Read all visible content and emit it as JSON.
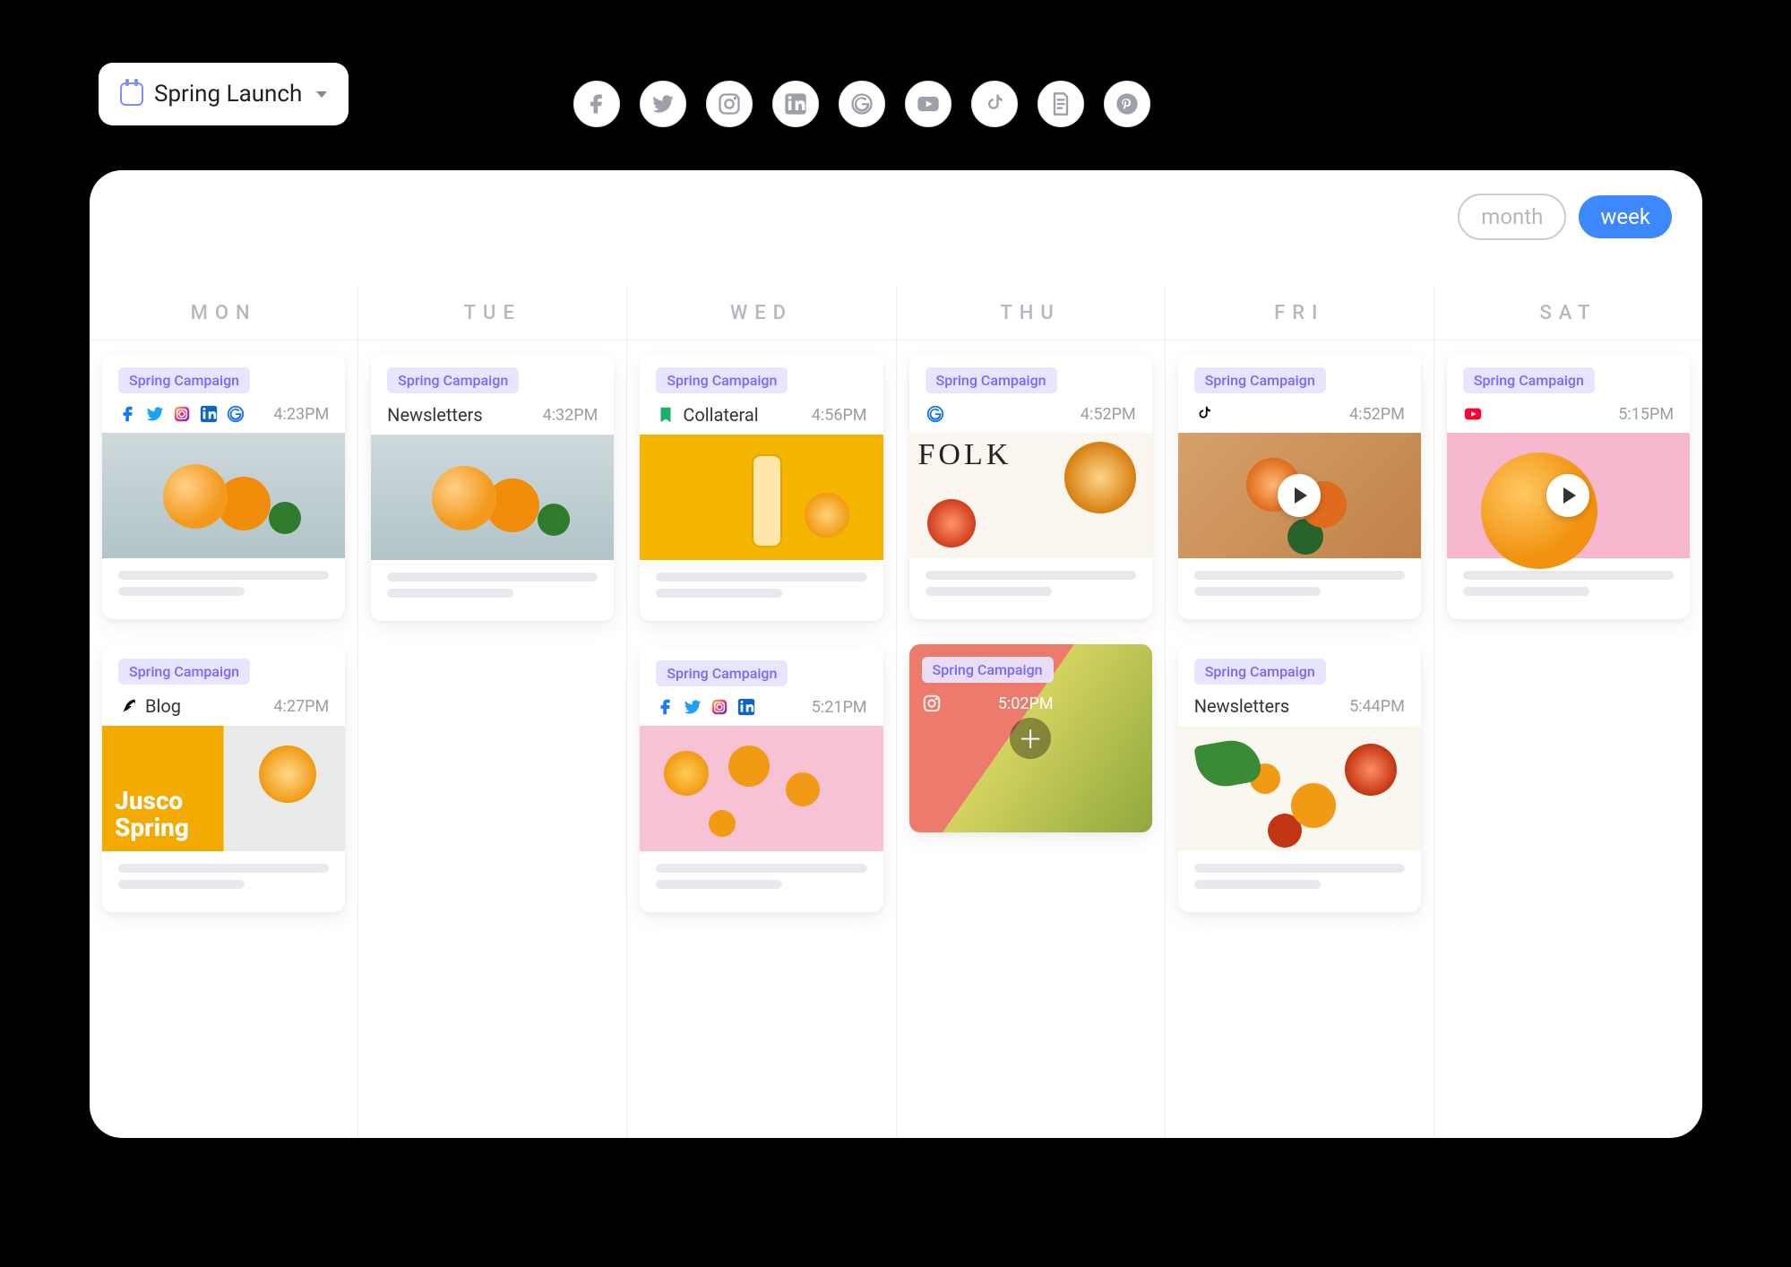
{
  "campaign": {
    "name": "Spring Launch"
  },
  "channels": [
    "facebook",
    "twitter",
    "instagram",
    "linkedin",
    "google",
    "youtube",
    "tiktok",
    "blog",
    "pinterest"
  ],
  "view": {
    "month": "month",
    "week": "week",
    "active": "week"
  },
  "days": [
    "MON",
    "TUE",
    "WED",
    "THU",
    "FRI",
    "SAT"
  ],
  "tag_label": "Spring Campaign",
  "cards": {
    "mon": [
      {
        "tag": "Spring Campaign",
        "icons": [
          "facebook",
          "twitter",
          "instagram",
          "linkedin",
          "google"
        ],
        "time": "4:23PM",
        "thumb": "t-oranges",
        "footer": true
      },
      {
        "tag": "Spring Campaign",
        "icons": [
          "blog"
        ],
        "label": "Blog",
        "time": "4:27PM",
        "thumb": "t-split",
        "thumb_text": "Jusco Spring",
        "footer": true
      }
    ],
    "tue": [
      {
        "tag": "Spring Campaign",
        "label": "Newsletters",
        "time": "4:32PM",
        "thumb": "t-oranges",
        "footer": true
      }
    ],
    "wed": [
      {
        "tag": "Spring Campaign",
        "icons": [
          "collateral"
        ],
        "label": "Collateral",
        "time": "4:56PM",
        "thumb": "t-juice",
        "footer": true
      },
      {
        "tag": "Spring Campaign",
        "icons": [
          "facebook",
          "twitter",
          "instagram",
          "linkedin"
        ],
        "time": "5:21PM",
        "thumb": "t-pink",
        "footer": true
      }
    ],
    "thu": [
      {
        "tag": "Spring Campaign",
        "icons": [
          "google"
        ],
        "time": "4:52PM",
        "thumb": "t-folk",
        "thumb_word": "FOLK",
        "footer": true
      },
      {
        "tag": "Spring Campaign",
        "icons": [
          "instagram-white"
        ],
        "time": "5:02PM",
        "thumb": "t-grape",
        "overlay": true,
        "add": true
      }
    ],
    "fri": [
      {
        "tag": "Spring Campaign",
        "icons": [
          "tiktok"
        ],
        "time": "4:52PM",
        "thumb": "t-wood",
        "play": true,
        "footer": true
      },
      {
        "tag": "Spring Campaign",
        "label": "Newsletters",
        "time": "5:44PM",
        "thumb": "t-board",
        "footer": true
      }
    ],
    "sat": [
      {
        "tag": "Spring Campaign",
        "icons": [
          "youtube"
        ],
        "time": "5:15PM",
        "thumb": "t-hand",
        "play": true,
        "footer": true
      }
    ]
  }
}
